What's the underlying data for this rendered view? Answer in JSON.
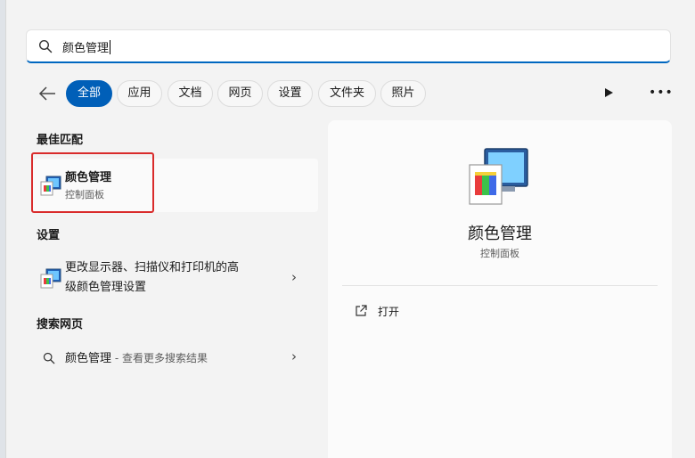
{
  "search": {
    "query": "颜色管理"
  },
  "filters": {
    "chips": [
      "全部",
      "应用",
      "文档",
      "网页",
      "设置",
      "文件夹",
      "照片"
    ],
    "active": "全部"
  },
  "best_match": {
    "section_title": "最佳匹配",
    "title": "颜色管理",
    "subtitle": "控制面板"
  },
  "settings": {
    "section_title": "设置",
    "item_line1": "更改显示器、扫描仪和打印机的高",
    "item_line2": "级颜色管理设置"
  },
  "web": {
    "section_title": "搜索网页",
    "query": "颜色管理",
    "suffix": " - 查看更多搜索结果"
  },
  "detail": {
    "title": "颜色管理",
    "type": "控制面板",
    "open_label": "打开"
  },
  "colors": {
    "accent": "#005fb8",
    "highlight": "#d92b2b"
  }
}
